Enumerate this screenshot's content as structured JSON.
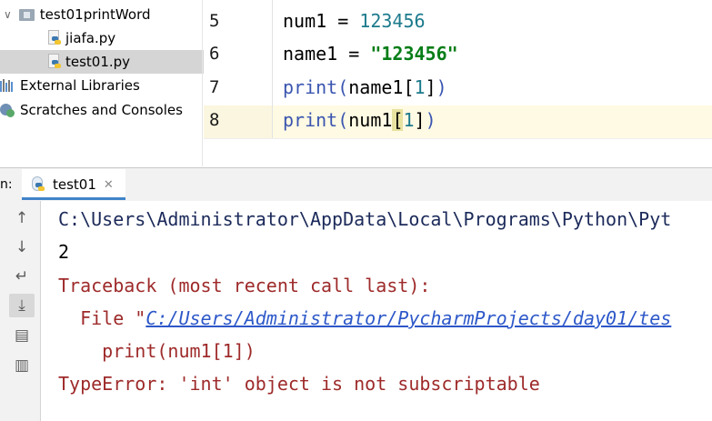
{
  "project_tree": {
    "folder": "test01printWord",
    "files": [
      "jiafa.py",
      "test01.py"
    ],
    "selected_file": "test01.py",
    "external_libraries": "External Libraries",
    "scratches": "Scratches and Consoles"
  },
  "editor": {
    "line_numbers": [
      "5",
      "6",
      "7",
      "8"
    ],
    "lines": {
      "l5": {
        "name": "num1",
        "eq": " = ",
        "value": "123456"
      },
      "l6": {
        "name": "name1",
        "eq": " = ",
        "value": "\"123456\""
      },
      "l7": {
        "fn": "print",
        "open": "(",
        "arg": "name1",
        "lb": "[",
        "idx": "1",
        "rb": "]",
        "close": ")"
      },
      "l8": {
        "fn": "print",
        "open": "(",
        "arg": "num1",
        "lb": "[",
        "idx": "1",
        "rb": "]",
        "close": ")"
      }
    }
  },
  "run": {
    "label": "n:",
    "tab": "test01",
    "close_glyph": "✕"
  },
  "console": {
    "path_line": "C:\\Users\\Administrator\\AppData\\Local\\Programs\\Python\\Pyt",
    "output": "2",
    "traceback": "Traceback (most recent call last):",
    "file_prefix": "  File \"",
    "file_link": "C:/Users/Administrator/PycharmProjects/day01/tes",
    "code": "    print(num1[1])",
    "error": "TypeError: 'int' object is not subscriptable"
  },
  "colors": {
    "selection": "#d5d5d5",
    "current_line": "#fffae3",
    "tab_underline": "#4083c9",
    "error_text": "#9e2a2a",
    "link": "#2d58c9"
  }
}
